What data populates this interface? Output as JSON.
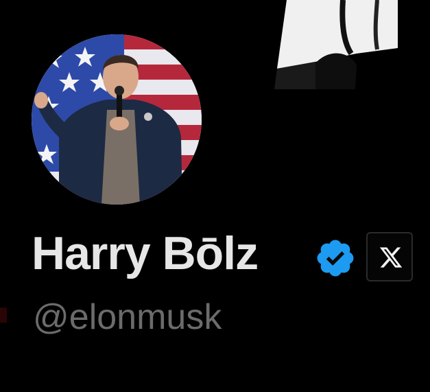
{
  "profile": {
    "display_name": "Harry Bōlz",
    "handle": "@elonmusk",
    "verified_icon": "verified-badge-icon",
    "affiliation_icon": "x-logo-icon",
    "colors": {
      "background": "#000000",
      "name": "#e6e6e6",
      "handle": "#6b6b6b",
      "verified": "#1d9bf0"
    }
  }
}
